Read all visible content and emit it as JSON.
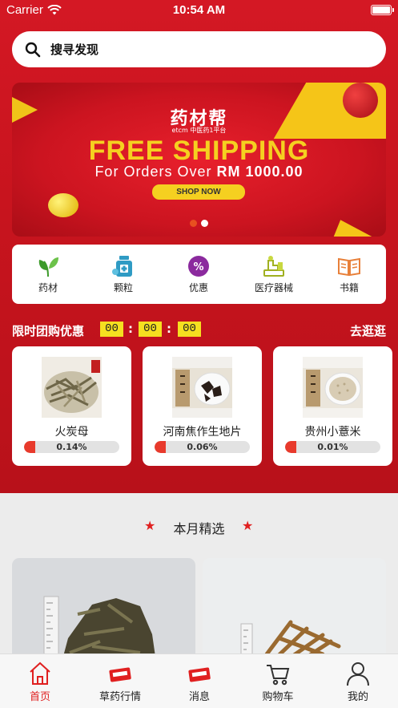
{
  "status_bar": {
    "carrier": "Carrier",
    "time": "10:54 AM"
  },
  "search": {
    "placeholder": "搜寻发现"
  },
  "banner": {
    "logo": "药材帮",
    "subtitle": "etcm 中医药1平台",
    "headline": "FREE SHIPPING",
    "orders_prefix": "For Orders Over",
    "orders_amount": "RM 1000.00",
    "cta": "SHOP NOW",
    "active_slide": 1,
    "slide_count": 2
  },
  "categories": [
    {
      "label": "药材",
      "icon": "herb-leaf-icon",
      "color": "#3c9a2a"
    },
    {
      "label": "颗粒",
      "icon": "medicine-bottle-icon",
      "color": "#2f9bc4"
    },
    {
      "label": "优惠",
      "icon": "discount-badge-icon",
      "color": "#8b2a9e"
    },
    {
      "label": "医疗器械",
      "icon": "medical-device-icon",
      "color": "#a0b020"
    },
    {
      "label": "书籍",
      "icon": "book-icon",
      "color": "#e8803a"
    }
  ],
  "flash_sale": {
    "title": "限时团购优惠",
    "timer": [
      "00",
      "00",
      "00"
    ],
    "go_shopping": "去逛逛",
    "items": [
      {
        "name": "火炭母",
        "percent": "0.14%",
        "progress": 0.0014
      },
      {
        "name": "河南焦作生地片",
        "percent": "0.06%",
        "progress": 0.0006
      },
      {
        "name": "贵州小薏米",
        "percent": "0.01%",
        "progress": 0.0001
      }
    ]
  },
  "monthly": {
    "title": "本月精选"
  },
  "tabbar": {
    "items": [
      {
        "label": "首页",
        "icon": "home-icon",
        "active": true
      },
      {
        "label": "草药行情",
        "icon": "herb-market-icon",
        "active": false
      },
      {
        "label": "消息",
        "icon": "message-icon",
        "active": false
      },
      {
        "label": "购物车",
        "icon": "shopping-cart-icon",
        "active": false
      },
      {
        "label": "我的",
        "icon": "profile-icon",
        "active": false
      }
    ]
  },
  "colors": {
    "primary_red": "#d41824",
    "accent_yellow": "#f5d020",
    "progress_red": "#e83a2c"
  }
}
